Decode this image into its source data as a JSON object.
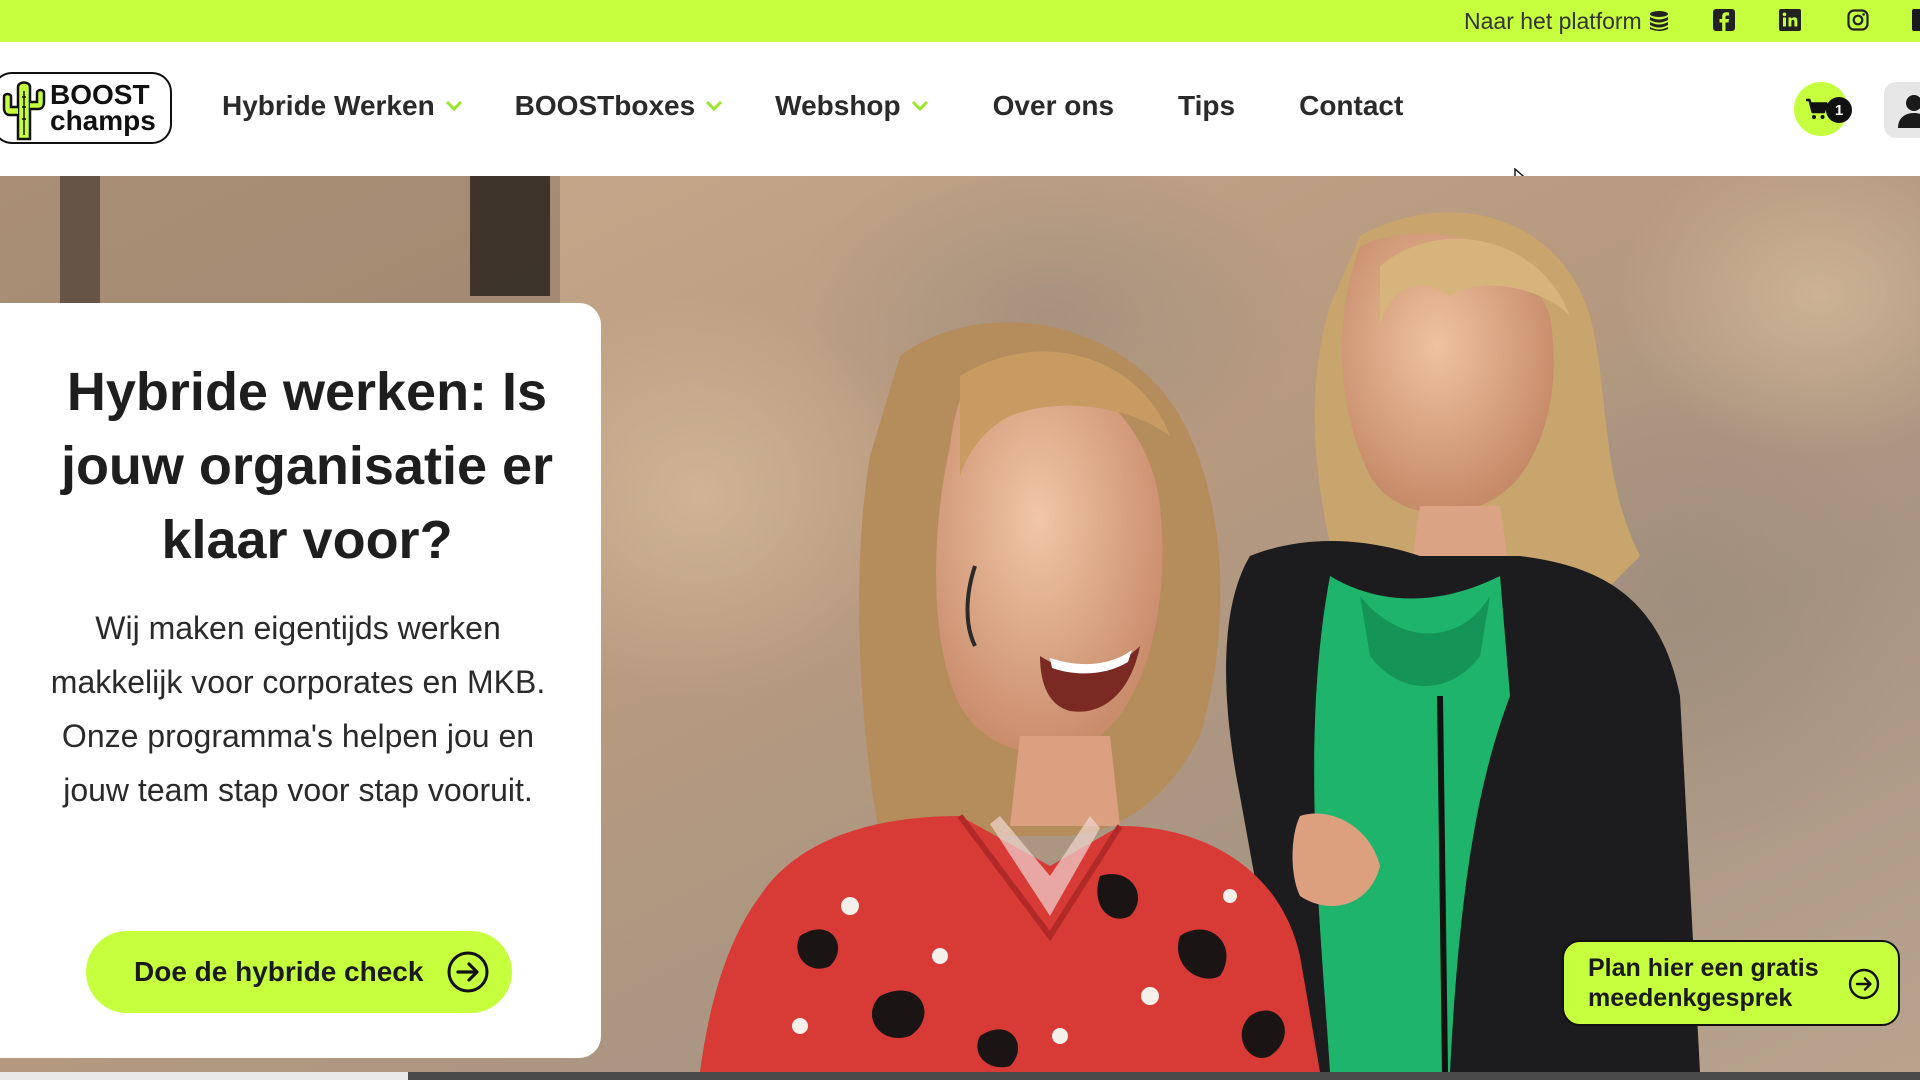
{
  "topbar": {
    "platform_label": "Naar het platform",
    "icons": [
      "stack-icon",
      "facebook-icon",
      "linkedin-icon",
      "instagram-icon"
    ],
    "bg_color": "#c6ff3d"
  },
  "logo": {
    "line1": "BOOST",
    "line2": "champs"
  },
  "nav": {
    "items": [
      {
        "label": "Hybride Werken",
        "has_dropdown": true
      },
      {
        "label": "BOOSTboxes",
        "has_dropdown": true
      },
      {
        "label": "Webshop",
        "has_dropdown": true
      },
      {
        "label": "Over ons",
        "has_dropdown": false
      },
      {
        "label": "Tips",
        "has_dropdown": false
      },
      {
        "label": "Contact",
        "has_dropdown": false
      }
    ]
  },
  "cart": {
    "count": "1"
  },
  "hero": {
    "title": "Hybride werken: Is jouw organisatie er klaar voor?",
    "description": "Wij maken eigentijds werken makkelijk voor corporates en MKB. Onze programma's helpen jou en jouw team stap voor stap vooruit.",
    "cta_label": "Doe de hybride check"
  },
  "floating_button": {
    "label": "Plan hier een gratis meedenkgesprek"
  },
  "colors": {
    "accent": "#c6ff3d",
    "text": "#1e1e1e"
  }
}
